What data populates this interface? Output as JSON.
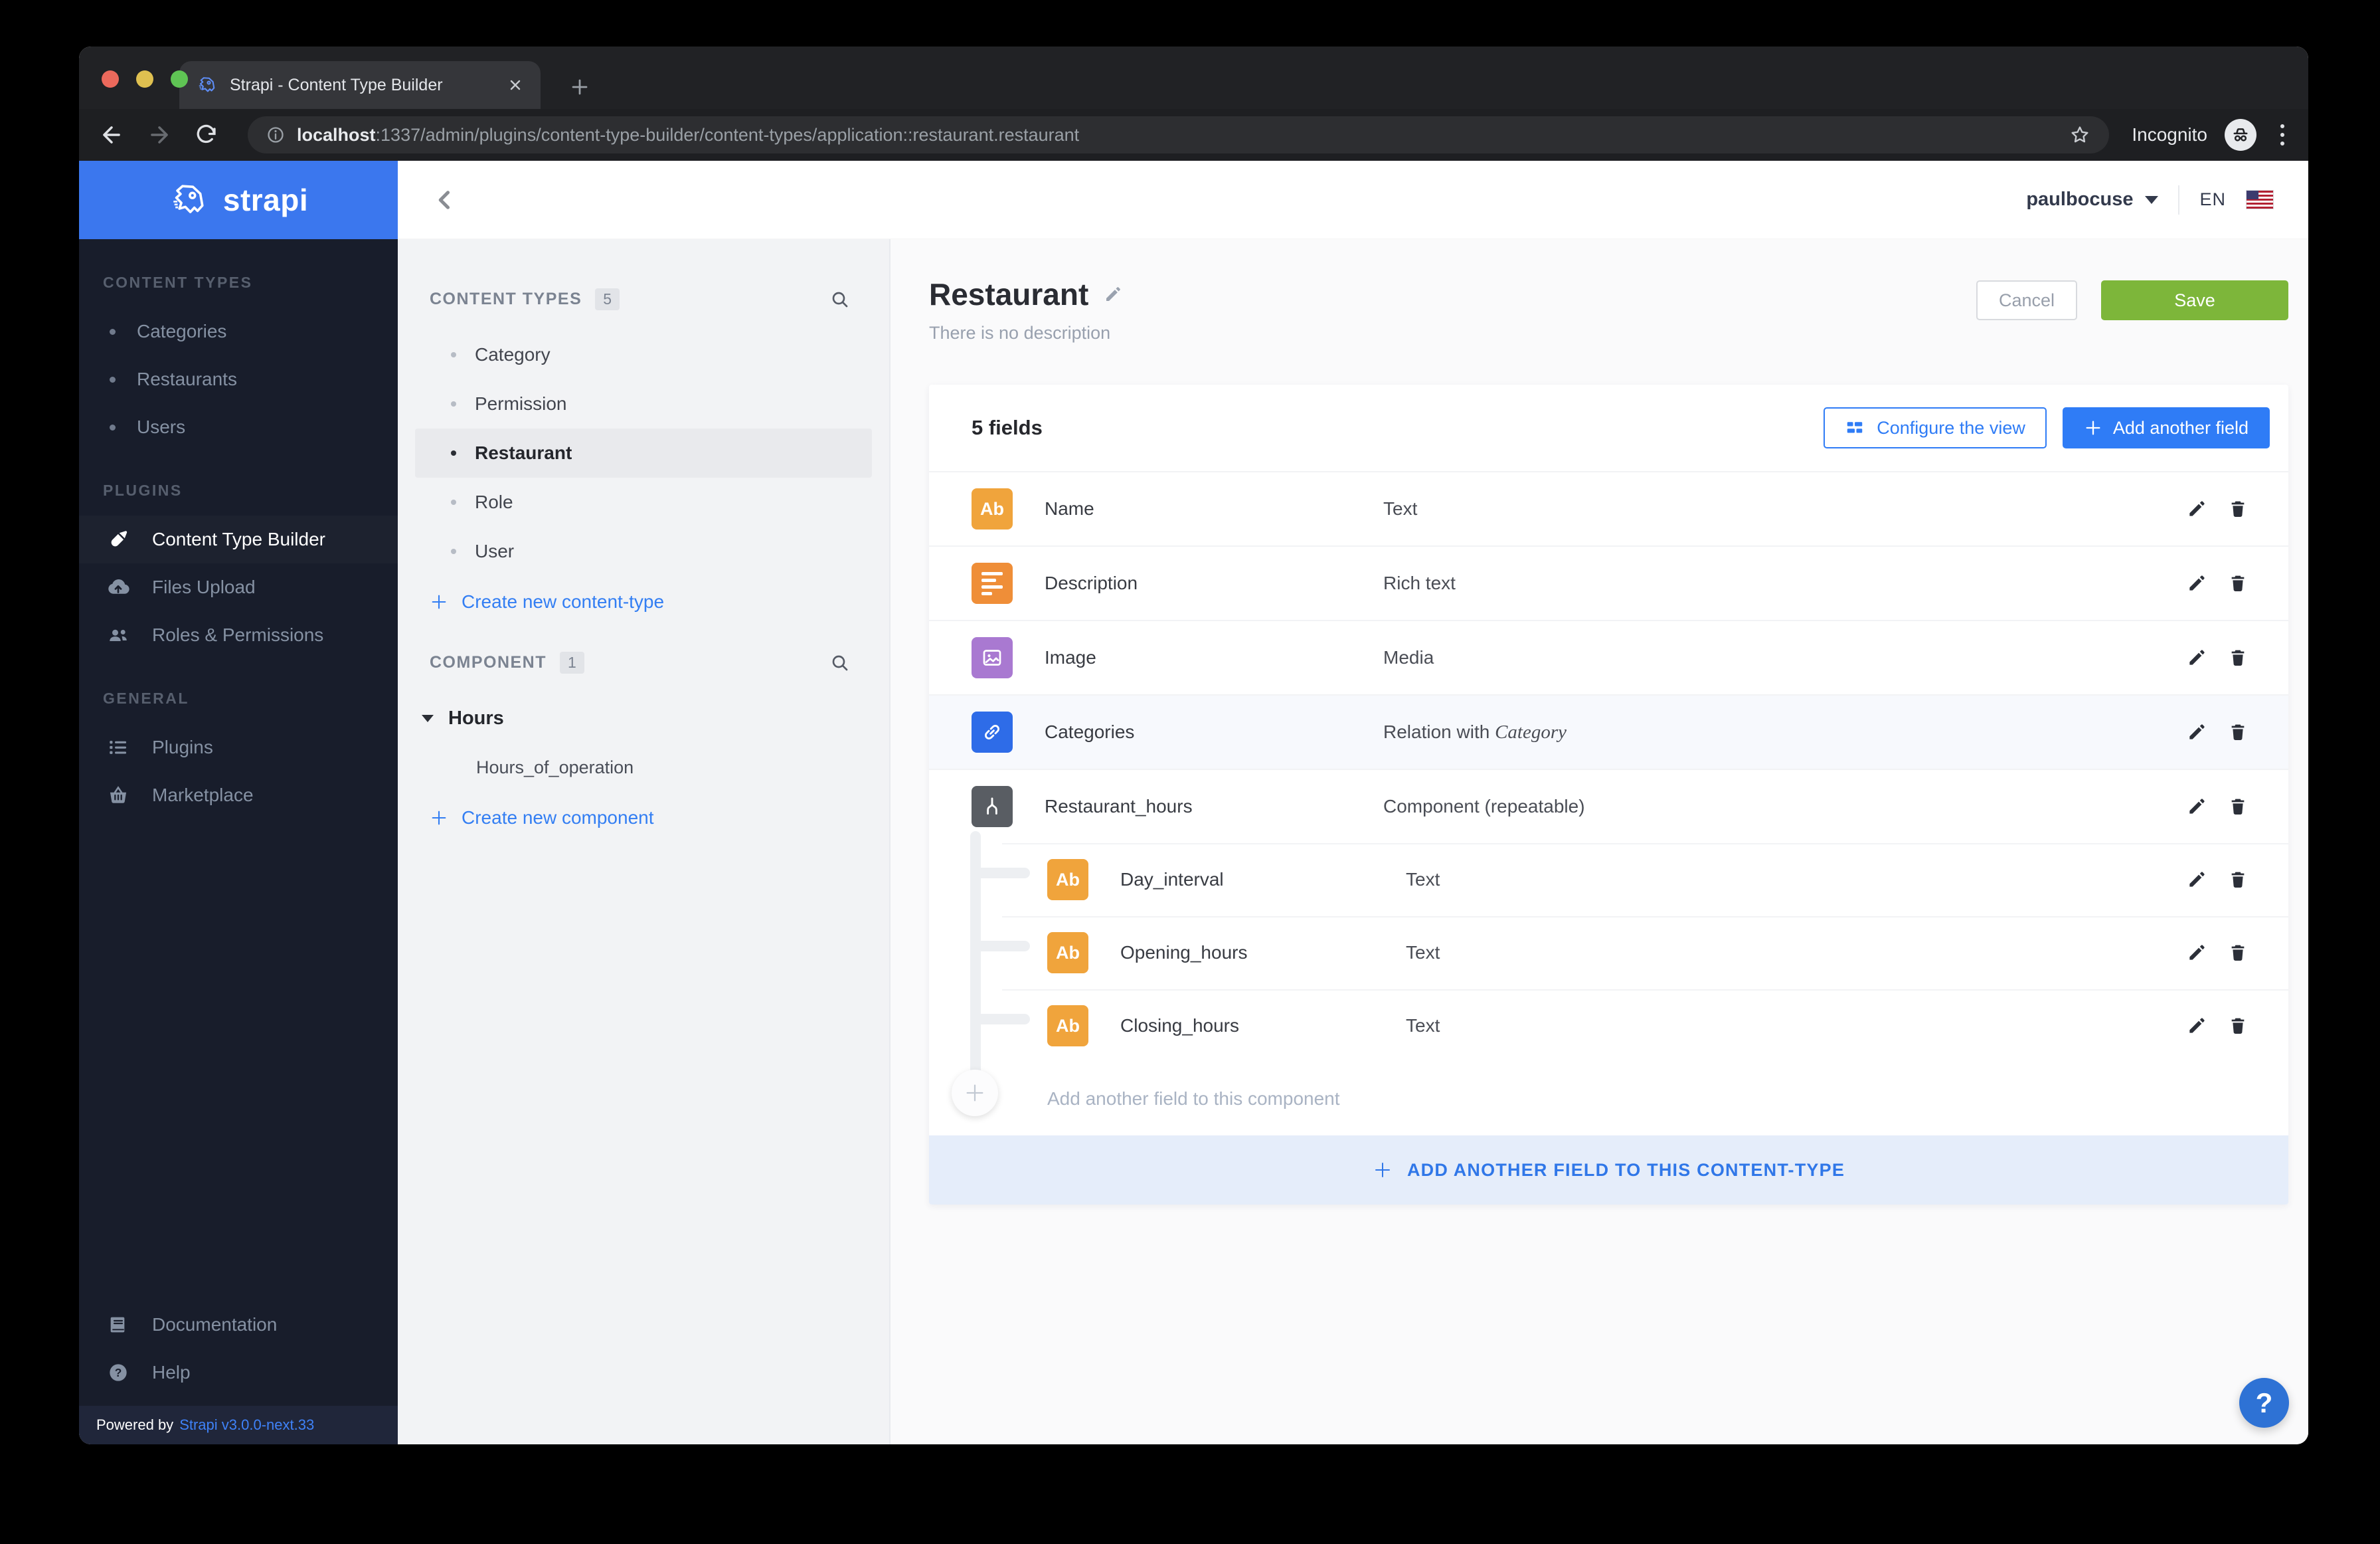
{
  "browser": {
    "tab_title": "Strapi - Content Type Builder",
    "url_host": "localhost",
    "url_rest": ":1337/admin/plugins/content-type-builder/content-types/application::restaurant.restaurant",
    "incognito_label": "Incognito"
  },
  "app_header": {
    "brand": "strapi",
    "user_name": "paulbocuse",
    "locale": "EN"
  },
  "sidebar": {
    "sections": [
      {
        "title": "CONTENT TYPES",
        "items": [
          {
            "label": "Categories"
          },
          {
            "label": "Restaurants"
          },
          {
            "label": "Users"
          }
        ]
      },
      {
        "title": "PLUGINS",
        "items": [
          {
            "label": "Content Type Builder",
            "icon": "paintbrush-icon",
            "active": true
          },
          {
            "label": "Files Upload",
            "icon": "cloud-upload-icon"
          },
          {
            "label": "Roles & Permissions",
            "icon": "users-icon"
          }
        ]
      },
      {
        "title": "GENERAL",
        "items": [
          {
            "label": "Plugins",
            "icon": "list-icon"
          },
          {
            "label": "Marketplace",
            "icon": "basket-icon"
          }
        ]
      }
    ],
    "footer_items": [
      {
        "label": "Documentation",
        "icon": "book-icon"
      },
      {
        "label": "Help",
        "icon": "help-circle-icon"
      }
    ],
    "powered_by": "Powered by",
    "version": "Strapi v3.0.0-next.33"
  },
  "builder_nav": {
    "content_types": {
      "title": "CONTENT TYPES",
      "count": "5",
      "items": [
        "Category",
        "Permission",
        "Restaurant",
        "Role",
        "User"
      ],
      "active_item": "Restaurant",
      "create_label": "Create new content-type"
    },
    "components": {
      "title": "COMPONENT",
      "count": "1",
      "group_label": "Hours",
      "items": [
        "Hours_of_operation"
      ],
      "create_label": "Create new component"
    }
  },
  "content": {
    "title": "Restaurant",
    "description": "There is no description",
    "cancel_label": "Cancel",
    "save_label": "Save",
    "fields_count": "5 fields",
    "configure_label": "Configure the view",
    "add_field_label": "Add another field",
    "rows": [
      {
        "name": "Name",
        "type": "Text",
        "badge_text": "Ab",
        "icon": "text-field-icon"
      },
      {
        "name": "Description",
        "type": "Rich text",
        "icon": "richtext-icon"
      },
      {
        "name": "Image",
        "type": "Media",
        "icon": "media-icon"
      },
      {
        "name": "Categories",
        "type_prefix": "Relation with ",
        "type_target": "Category",
        "icon": "relation-icon"
      },
      {
        "name": "Restaurant_hours",
        "type": "Component (repeatable)",
        "icon": "component-icon"
      },
      {
        "name": "Day_interval",
        "type": "Text",
        "badge_text": "Ab",
        "icon": "text-field-icon",
        "nested": true
      },
      {
        "name": "Opening_hours",
        "type": "Text",
        "badge_text": "Ab",
        "icon": "text-field-icon",
        "nested": true
      },
      {
        "name": "Closing_hours",
        "type": "Text",
        "badge_text": "Ab",
        "icon": "text-field-icon",
        "nested": true
      }
    ],
    "add_component_field_label": "Add another field to this component",
    "add_content_type_field_label": "ADD ANOTHER FIELD TO THIS CONTENT-TYPE",
    "help_glyph": "?"
  },
  "colors": {
    "strapi_blue": "#3b77ee",
    "accent_blue": "#2f7cf6",
    "save_green": "#7db63a",
    "sidebar_dark": "#181d2b",
    "badge_text_yellow": "#f0a43c",
    "badge_richtext_orange": "#ef8e38",
    "badge_media_purple": "#a979d1",
    "badge_relation_blue": "#2e6ce8",
    "badge_component_gray": "#595d63",
    "band_blue": "#e5edfa",
    "help_fab_blue": "#2e72d5"
  }
}
